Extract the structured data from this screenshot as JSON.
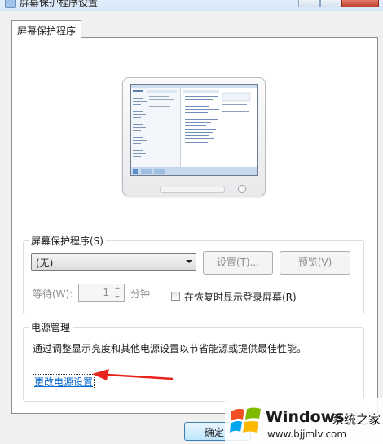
{
  "window": {
    "title": "屏幕保护程序设置"
  },
  "tab": {
    "label": "屏幕保护程序"
  },
  "screensaver": {
    "group_label": "屏幕保护程序(S)",
    "selected": "(无)",
    "settings_label": "设置(T)...",
    "preview_label": "预览(V)",
    "wait_label": "等待(W):",
    "wait_value": "1",
    "minutes_label": "分钟",
    "resume_label": "在恢复时显示登录屏幕(R)",
    "resume_checked": false
  },
  "power": {
    "group_label": "电源管理",
    "description": "通过调整显示亮度和其他电源设置以节省能源或提供最佳性能。",
    "link_label": "更改电源设置"
  },
  "footer": {
    "ok_label": "确定"
  },
  "watermark": {
    "brand": "Windows",
    "suffix": "系统之家",
    "url": "www.bjjmlv.com"
  },
  "colors": {
    "link": "#0066cc",
    "arrow": "#e8231b",
    "win_red": "#f25022",
    "win_green": "#7fba00",
    "win_blue": "#00a4ef",
    "win_yellow": "#ffb900"
  }
}
